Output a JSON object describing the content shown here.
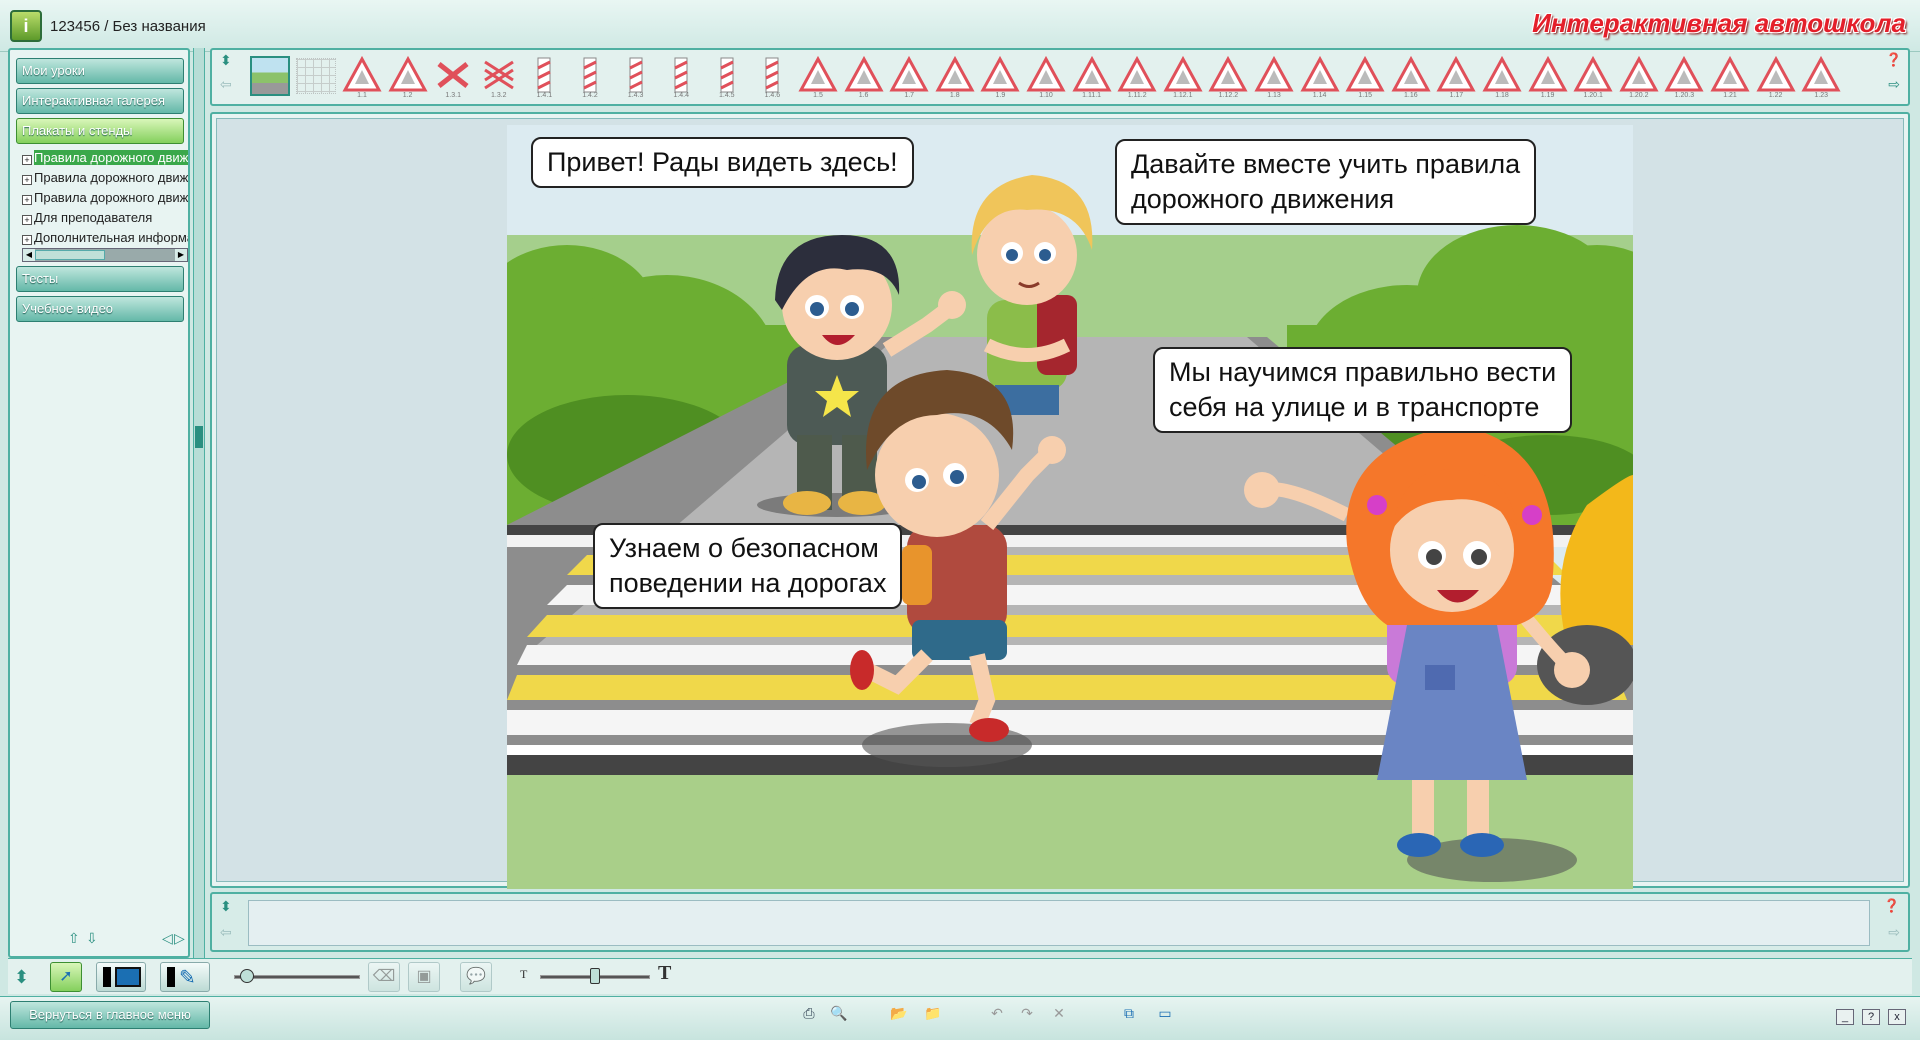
{
  "window": {
    "title": "123456 / Без названия",
    "brand": "Интерактивная автошкола",
    "app_icon": "app-logo-icon"
  },
  "sidebar": {
    "buttons": [
      {
        "label": "Мои уроки",
        "active": false
      },
      {
        "label": "Интерактивная галерея",
        "active": false
      },
      {
        "label": "Плакаты и стенды",
        "active": true
      },
      {
        "label": "Тесты",
        "active": false
      },
      {
        "label": "Учебное видео",
        "active": false
      }
    ],
    "tree": [
      {
        "label": "Правила дорожного движения",
        "selected": true
      },
      {
        "label": "Правила дорожного движения",
        "selected": false
      },
      {
        "label": "Правила дорожного движения",
        "selected": false
      },
      {
        "label": "Для преподавателя",
        "selected": false
      },
      {
        "label": "Дополнительная информация",
        "selected": false
      }
    ],
    "nav_icons": [
      "arrow-up-icon",
      "arrow-down-icon",
      "arrow-left-icon",
      "arrow-right-icon"
    ]
  },
  "signbar": {
    "signs": [
      "1.1",
      "1.2",
      "1.3.1",
      "1.3.2",
      "1.4.1",
      "1.4.2",
      "1.4.3",
      "1.4.4",
      "1.4.5",
      "1.4.6",
      "1.5",
      "1.6",
      "1.7",
      "1.8",
      "1.9",
      "1.10",
      "1.11.1",
      "1.11.2",
      "1.12.1",
      "1.12.2",
      "1.13",
      "1.14",
      "1.15",
      "1.16",
      "1.17",
      "1.18",
      "1.19",
      "1.20.1",
      "1.20.2",
      "1.20.3",
      "1.21",
      "1.22",
      "1.23"
    ]
  },
  "scene": {
    "bubbles": [
      {
        "text": "Привет! Рады видеть здесь!"
      },
      {
        "line1": "Давайте вместе учить правила",
        "line2": "дорожного движения"
      },
      {
        "line1": "Мы научимся правильно вести",
        "line2": "себя на улице и в транспорте"
      },
      {
        "line1": "Узнаем о безопасном",
        "line2": "поведении на дорогах"
      }
    ]
  },
  "notes": {
    "value": ""
  },
  "toolbar": {
    "slider1_value": 0.05,
    "slider2_value": 0.5
  },
  "statusbar": {
    "back_label": "Вернуться в главное меню",
    "icons": [
      "print-icon",
      "zoom-icon",
      "open-folder-icon",
      "save-folder-icon",
      "undo-icon",
      "redo-icon",
      "delete-icon",
      "layout-icon",
      "screen-icon"
    ],
    "window_controls": {
      "minimize": "_",
      "help": "?",
      "close": "x"
    }
  },
  "colors": {
    "accent": "#4fb0a2",
    "active_green": "#84d05d",
    "brand_red": "#e41f2a",
    "sign_red": "#e0505a"
  }
}
